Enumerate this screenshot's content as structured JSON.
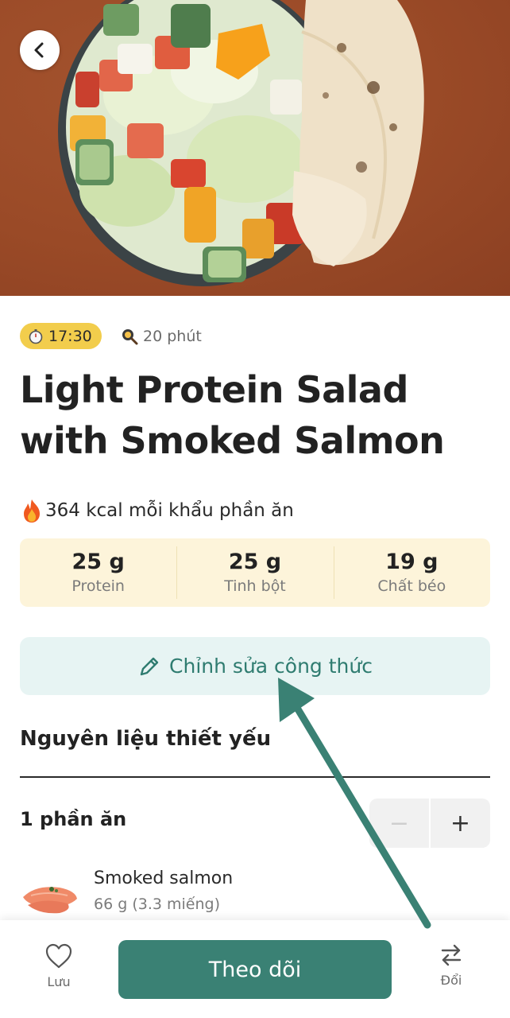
{
  "hero": {
    "image": "salad-with-salmon-and-flatbread"
  },
  "nav": {
    "back_icon": "chevron-left-icon"
  },
  "meta": {
    "time": "17:30",
    "time_icon": "stopwatch-icon",
    "duration": "20 phút",
    "duration_icon": "frying-pan-icon"
  },
  "recipe": {
    "title": "Light Protein Salad with Smoked Salmon",
    "kcal_icon": "fire-icon",
    "kcal_text": "364 kcal mỗi khẩu phần ăn"
  },
  "macros": [
    {
      "value": "25 g",
      "label": "Protein"
    },
    {
      "value": "25 g",
      "label": "Tinh bột"
    },
    {
      "value": "19 g",
      "label": "Chất béo"
    }
  ],
  "edit": {
    "label": "Chỉnh sửa công thức",
    "icon": "pencil-icon"
  },
  "ingredients": {
    "section_title": "Nguyên liệu thiết yếu",
    "servings": "1 phần ăn",
    "minus": "−",
    "plus": "+",
    "items": [
      {
        "name": "Smoked salmon",
        "qty": "66 g (3.3 miếng)"
      }
    ]
  },
  "bottom": {
    "save_label": "Lưu",
    "follow_label": "Theo dõi",
    "swap_label": "Đổi"
  },
  "colors": {
    "accent": "#3a8174",
    "badge": "#f2cd4c",
    "macro_bg": "#fdf4da",
    "edit_bg": "#e7f4f3",
    "annotation_arrow": "#3a8174"
  }
}
